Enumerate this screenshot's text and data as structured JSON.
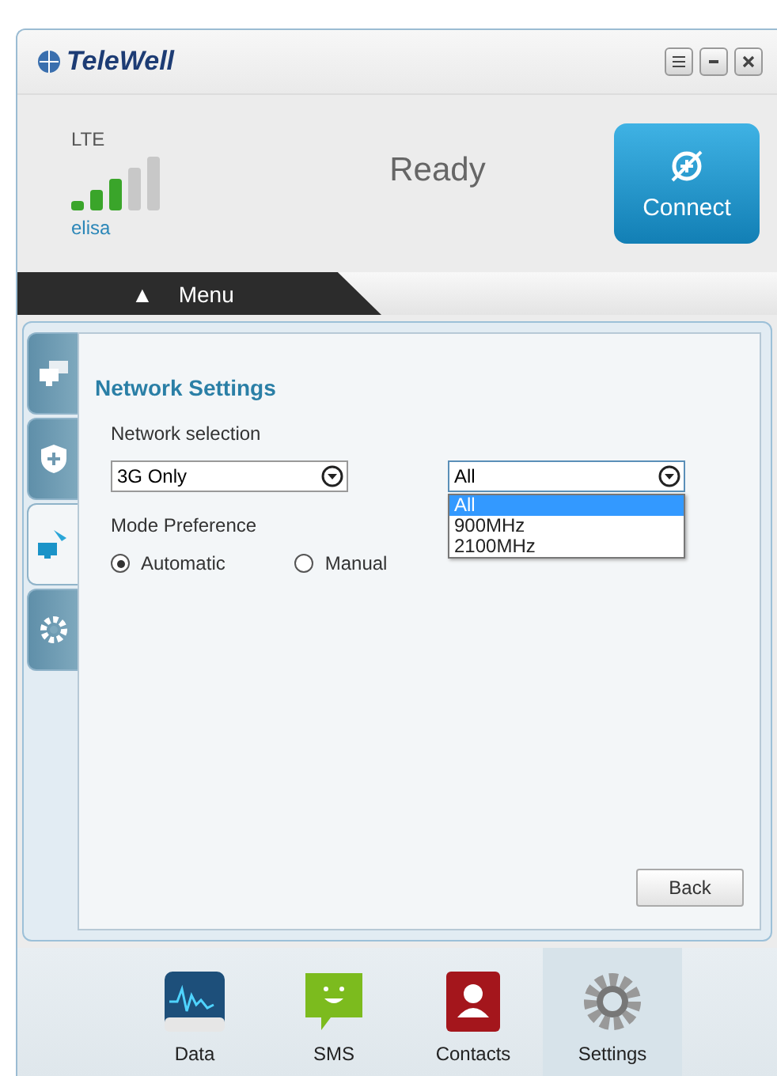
{
  "window": {
    "logo": "TeleWell"
  },
  "status": {
    "network_type": "LTE",
    "operator": "elisa",
    "state": "Ready",
    "connect_button": "Connect"
  },
  "menu": {
    "label": "Menu",
    "arrow": "▲"
  },
  "side_tabs": [
    {
      "kind": "windows",
      "selected": false
    },
    {
      "kind": "shield",
      "selected": false
    },
    {
      "kind": "network",
      "selected": true
    },
    {
      "kind": "gear",
      "selected": false
    }
  ],
  "settings": {
    "title": "Network Settings",
    "network_label": "Network selection",
    "network_value": "3G Only",
    "band": {
      "value": "All",
      "expanded": true,
      "options": [
        {
          "label": "All",
          "selected": true
        },
        {
          "label": "900MHz",
          "selected": false
        },
        {
          "label": "2100MHz",
          "selected": false
        }
      ]
    },
    "mode_label": "Mode Preference",
    "modes": [
      {
        "label": "Automatic",
        "selected": true
      },
      {
        "label": "Manual",
        "selected": false
      }
    ],
    "back_button": "Back"
  },
  "nav": [
    {
      "kind": "data",
      "label": "Data",
      "selected": false
    },
    {
      "kind": "sms",
      "label": "SMS",
      "selected": false
    },
    {
      "kind": "contacts",
      "label": "Contacts",
      "selected": false
    },
    {
      "kind": "settings",
      "label": "Settings",
      "selected": true
    }
  ]
}
